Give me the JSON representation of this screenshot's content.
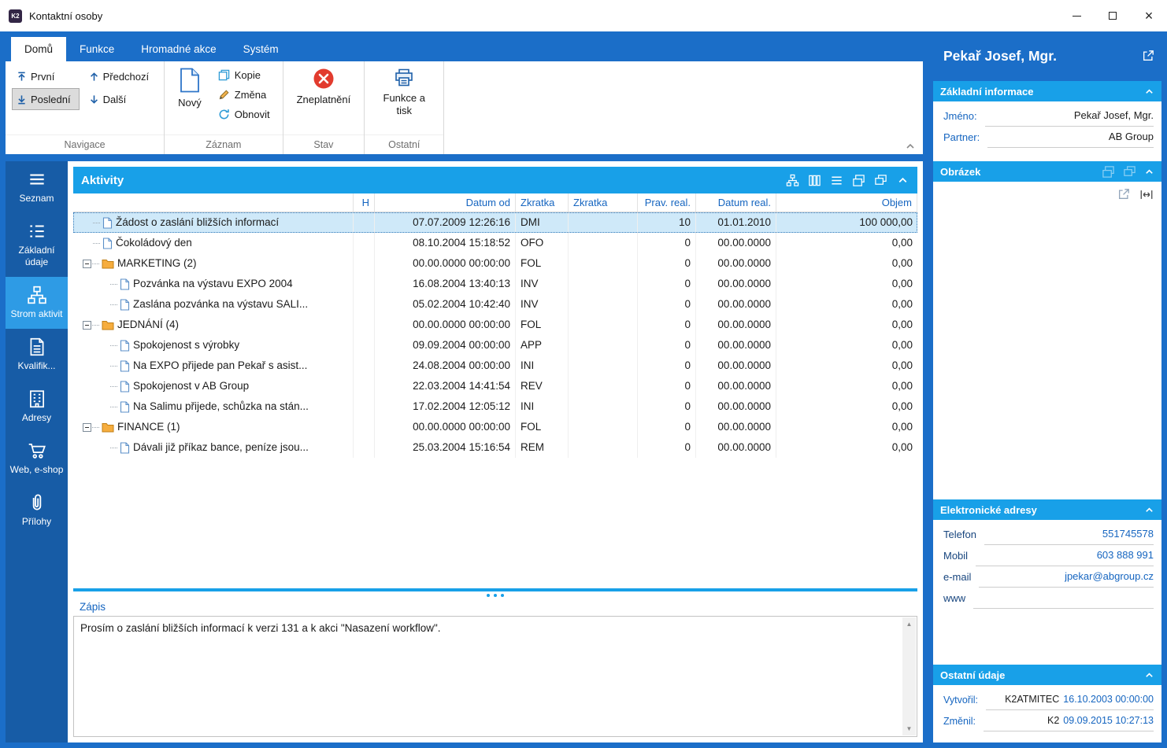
{
  "colors": {
    "chrome_blue": "#1B6EC8",
    "sidebar_blue": "#175CA6",
    "active_item_blue": "#2E9BE5",
    "section_header_blue": "#18A0E8",
    "link_blue": "#1565C0",
    "selected_row": "#CFE9F9",
    "folder_orange": "#F6AD3E",
    "invalid_red": "#E23B2E"
  },
  "window": {
    "title": "Kontaktní osoby",
    "logo": "K2",
    "control_icons": [
      "minimize-icon",
      "maximize-icon",
      "close-icon"
    ]
  },
  "ribbon": {
    "tabs": [
      {
        "id": "domu",
        "label": "Domů",
        "active": true
      },
      {
        "id": "funkce",
        "label": "Funkce",
        "active": false
      },
      {
        "id": "hromadne-akce",
        "label": "Hromadné akce",
        "active": false
      },
      {
        "id": "system",
        "label": "Systém",
        "active": false
      }
    ],
    "navigace": {
      "label": "Navigace",
      "buttons": [
        {
          "id": "prvni",
          "label": "První",
          "icon": "arrow-up-bar",
          "pressed": false
        },
        {
          "id": "predchozi",
          "label": "Předchozí",
          "icon": "arrow-up",
          "pressed": false
        },
        {
          "id": "posledni",
          "label": "Poslední",
          "icon": "arrow-down-bar",
          "pressed": true
        },
        {
          "id": "dalsi",
          "label": "Další",
          "icon": "arrow-down",
          "pressed": false
        }
      ]
    },
    "zaznam": {
      "label": "Záznam",
      "new_label": "Nový",
      "buttons": [
        {
          "id": "kopie",
          "label": "Kopie",
          "icon": "copy"
        },
        {
          "id": "zmena",
          "label": "Změna",
          "icon": "pencil"
        },
        {
          "id": "obnovit",
          "label": "Obnovit",
          "icon": "refresh"
        }
      ]
    },
    "stav": {
      "label": "Stav",
      "invalidate_label": "Zneplatnění"
    },
    "ostatni": {
      "label": "Ostatní",
      "print_label": "Funkce a tisk"
    }
  },
  "sidebar": {
    "items": [
      {
        "id": "seznam",
        "label": "Seznam",
        "icon": "list",
        "active": false
      },
      {
        "id": "zakladni-udaje",
        "label": "Základní údaje",
        "icon": "form",
        "active": false
      },
      {
        "id": "strom-aktivit",
        "label": "Strom aktivit",
        "icon": "hierarchy",
        "active": true
      },
      {
        "id": "kvalifikace",
        "label": "Kvalifik...",
        "icon": "document",
        "active": false
      },
      {
        "id": "adresy",
        "label": "Adresy",
        "icon": "building",
        "active": false
      },
      {
        "id": "web-eshop",
        "label": "Web, e-shop",
        "icon": "cart",
        "active": false
      },
      {
        "id": "prilohy",
        "label": "Přílohy",
        "icon": "paperclip",
        "active": false
      }
    ]
  },
  "activities": {
    "title": "Aktivity",
    "header_icons": [
      "tree-structure",
      "columns",
      "list",
      "open-new-window",
      "duplicate",
      "collapse"
    ],
    "columns": [
      {
        "label": "",
        "align": "left"
      },
      {
        "label": "H",
        "align": "right"
      },
      {
        "label": "Datum od",
        "align": "right"
      },
      {
        "label": "Zkratka",
        "align": "left"
      },
      {
        "label": "Zkratka",
        "align": "left"
      },
      {
        "label": "Prav. real.",
        "align": "right"
      },
      {
        "label": "Datum real.",
        "align": "right"
      },
      {
        "label": "Objem",
        "align": "right"
      }
    ],
    "rows": [
      {
        "name": "Žádost o zaslání bližších informací",
        "icon": "document",
        "level": 0,
        "h": "",
        "datum_od": "07.07.2009 12:26:16",
        "zkratka": "DMI",
        "zkratka2": "",
        "prav_real": "10",
        "datum_real": "01.01.2010",
        "objem": "100 000,00",
        "selected": true
      },
      {
        "name": "Čokoládový den",
        "icon": "document",
        "level": 0,
        "h": "",
        "datum_od": "08.10.2004 15:18:52",
        "zkratka": "OFO",
        "zkratka2": "",
        "prav_real": "0",
        "datum_real": "00.00.0000",
        "objem": "0,00",
        "selected": false
      },
      {
        "name": "MARKETING (2)",
        "icon": "folder",
        "level": 0,
        "h": "",
        "datum_od": "00.00.0000 00:00:00",
        "zkratka": "FOL",
        "zkratka2": "",
        "prav_real": "0",
        "datum_real": "00.00.0000",
        "objem": "0,00",
        "selected": false
      },
      {
        "name": "Pozvánka na výstavu EXPO 2004",
        "icon": "document",
        "level": 1,
        "h": "",
        "datum_od": "16.08.2004 13:40:13",
        "zkratka": "INV",
        "zkratka2": "",
        "prav_real": "0",
        "datum_real": "00.00.0000",
        "objem": "0,00",
        "selected": false
      },
      {
        "name": "Zaslána pozvánka na výstavu SALI...",
        "icon": "document",
        "level": 1,
        "h": "",
        "datum_od": "05.02.2004 10:42:40",
        "zkratka": "INV",
        "zkratka2": "",
        "prav_real": "0",
        "datum_real": "00.00.0000",
        "objem": "0,00",
        "selected": false
      },
      {
        "name": "JEDNÁNÍ (4)",
        "icon": "folder",
        "level": 0,
        "h": "",
        "datum_od": "00.00.0000 00:00:00",
        "zkratka": "FOL",
        "zkratka2": "",
        "prav_real": "0",
        "datum_real": "00.00.0000",
        "objem": "0,00",
        "selected": false
      },
      {
        "name": "Spokojenost s výrobky",
        "icon": "document",
        "level": 1,
        "h": "",
        "datum_od": "09.09.2004 00:00:00",
        "zkratka": "APP",
        "zkratka2": "",
        "prav_real": "0",
        "datum_real": "00.00.0000",
        "objem": "0,00",
        "selected": false
      },
      {
        "name": "Na EXPO přijede pan Pekař s asist...",
        "icon": "document",
        "level": 1,
        "h": "",
        "datum_od": "24.08.2004 00:00:00",
        "zkratka": "INI",
        "zkratka2": "",
        "prav_real": "0",
        "datum_real": "00.00.0000",
        "objem": "0,00",
        "selected": false
      },
      {
        "name": "Spokojenost v AB Group",
        "icon": "document",
        "level": 1,
        "h": "",
        "datum_od": "22.03.2004 14:41:54",
        "zkratka": "REV",
        "zkratka2": "",
        "prav_real": "0",
        "datum_real": "00.00.0000",
        "objem": "0,00",
        "selected": false
      },
      {
        "name": "Na Salimu přijede, schůzka na stán...",
        "icon": "document",
        "level": 1,
        "h": "",
        "datum_od": "17.02.2004 12:05:12",
        "zkratka": "INI",
        "zkratka2": "",
        "prav_real": "0",
        "datum_real": "00.00.0000",
        "objem": "0,00",
        "selected": false
      },
      {
        "name": "FINANCE (1)",
        "icon": "folder",
        "level": 0,
        "h": "",
        "datum_od": "00.00.0000 00:00:00",
        "zkratka": "FOL",
        "zkratka2": "",
        "prav_real": "0",
        "datum_real": "00.00.0000",
        "objem": "0,00",
        "selected": false
      },
      {
        "name": "Dávali již příkaz bance, peníze jsou...",
        "icon": "document",
        "level": 1,
        "h": "",
        "datum_od": "25.03.2004 15:16:54",
        "zkratka": "REM",
        "zkratka2": "",
        "prav_real": "0",
        "datum_real": "00.00.0000",
        "objem": "0,00",
        "selected": false
      }
    ]
  },
  "zapis": {
    "title": "Zápis",
    "text": "Prosím o zaslání bližších informací k verzi 131 a k akci \"Nasazení workflow\"."
  },
  "detail": {
    "title": "Pekař Josef, Mgr.",
    "basic": {
      "title": "Základní informace",
      "fields": [
        {
          "label": "Jméno:",
          "value": "Pekař Josef, Mgr."
        },
        {
          "label": "Partner:",
          "value": "AB Group"
        }
      ]
    },
    "image": {
      "title": "Obrázek"
    },
    "electronic": {
      "title": "Elektronické adresy",
      "fields": [
        {
          "label": "Telefon",
          "value": "551745578"
        },
        {
          "label": "Mobil",
          "value": "603 888 991"
        },
        {
          "label": "e-mail",
          "value": "jpekar@abgroup.cz"
        },
        {
          "label": "www",
          "value": ""
        }
      ]
    },
    "other": {
      "title": "Ostatní údaje",
      "fields": [
        {
          "label": "Vytvořil:",
          "user": "K2ATMITEC",
          "date": "16.10.2003 00:00:00"
        },
        {
          "label": "Změnil:",
          "user": "K2",
          "date": "09.09.2015 10:27:13"
        }
      ]
    }
  }
}
